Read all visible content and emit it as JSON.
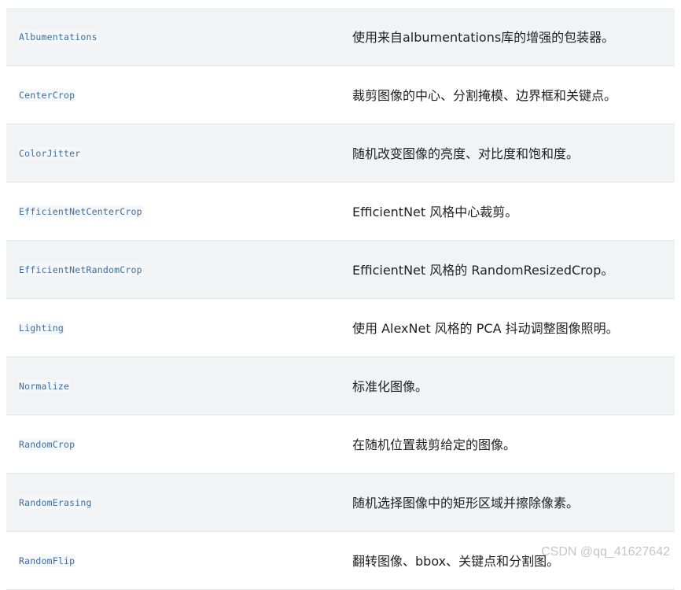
{
  "rows": [
    {
      "name": "Albumentations",
      "desc": "使用来自albumentations库的增强的包装器。"
    },
    {
      "name": "CenterCrop",
      "desc": "裁剪图像的中心、分割掩模、边界框和关键点。"
    },
    {
      "name": "ColorJitter",
      "desc": "随机改变图像的亮度、对比度和饱和度。"
    },
    {
      "name": "EfficientNetCenterCrop",
      "desc": "EfficientNet 风格中心裁剪。"
    },
    {
      "name": "EfficientNetRandomCrop",
      "desc": "EfficientNet 风格的 RandomResizedCrop。"
    },
    {
      "name": "Lighting",
      "desc": "使用 AlexNet 风格的 PCA 抖动调整图像照明。"
    },
    {
      "name": "Normalize",
      "desc": "标准化图像。"
    },
    {
      "name": "RandomCrop",
      "desc": "在随机位置裁剪给定的图像。"
    },
    {
      "name": "RandomErasing",
      "desc": "随机选择图像中的矩形区域并擦除像素。"
    },
    {
      "name": "RandomFlip",
      "desc": "翻转图像、bbox、关键点和分割图。"
    }
  ],
  "watermark": "CSDN @qq_41627642",
  "colors": {
    "row_stripe": "#f2f3f5",
    "code_text": "#3a6ea5",
    "desc_text": "#222222"
  }
}
